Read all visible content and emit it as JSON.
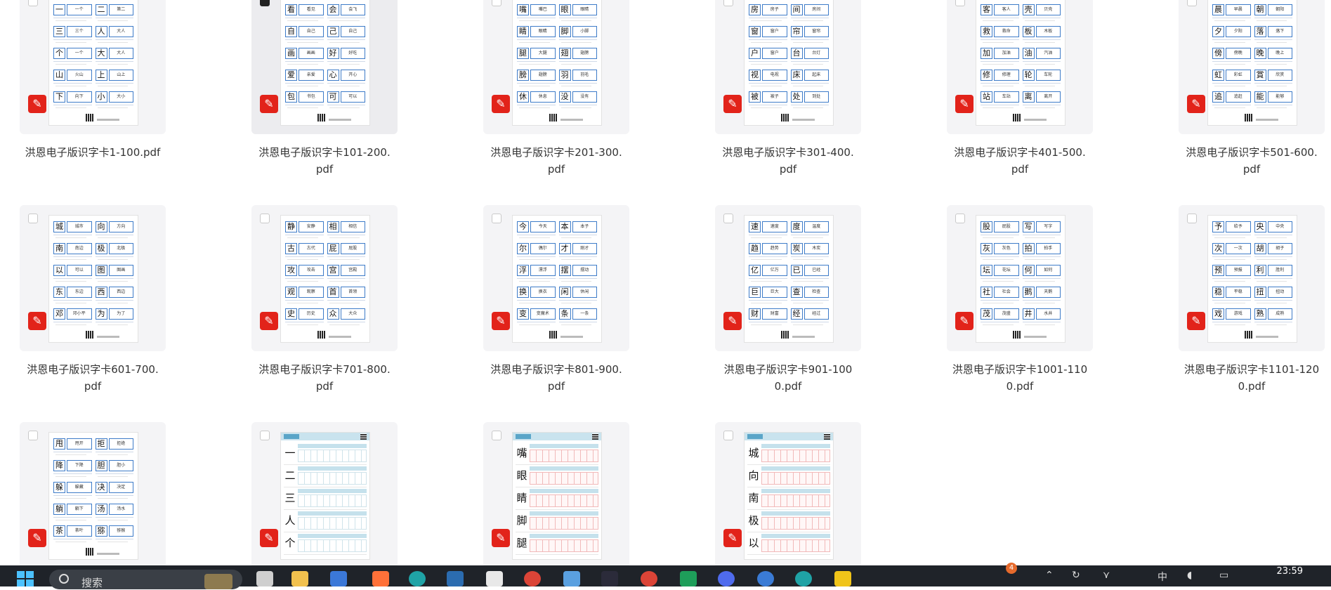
{
  "files": [
    {
      "name": "洪恩电子版识字卡1-100.pdf",
      "kind": "cards",
      "chars": [
        [
          "一",
          "一个"
        ],
        [
          "二",
          "第二"
        ],
        [
          "三",
          "三个"
        ],
        [
          "人",
          "大人"
        ],
        [
          "个",
          "一个"
        ],
        [
          "大",
          "大人"
        ],
        [
          "山",
          "火山"
        ],
        [
          "上",
          "山上"
        ],
        [
          "下",
          "向下"
        ],
        [
          "小",
          "大小"
        ]
      ]
    },
    {
      "name": "洪恩电子版识字卡101-200.\npdf",
      "kind": "cards",
      "checkbox": "dark",
      "highlighted": true,
      "chars": [
        [
          "看",
          "看见"
        ],
        [
          "会",
          "会飞"
        ],
        [
          "自",
          "自己"
        ],
        [
          "己",
          "自己"
        ],
        [
          "画",
          "画画"
        ],
        [
          "好",
          "好吃"
        ],
        [
          "爱",
          "亲爱"
        ],
        [
          "心",
          "开心"
        ],
        [
          "包",
          "书包"
        ],
        [
          "可",
          "可以"
        ]
      ]
    },
    {
      "name": "洪恩电子版识字卡201-300.\npdf",
      "kind": "cards",
      "chars": [
        [
          "嘴",
          "嘴巴"
        ],
        [
          "眼",
          "眼睛"
        ],
        [
          "睛",
          "眼睛"
        ],
        [
          "脚",
          "小脚"
        ],
        [
          "腿",
          "大腿"
        ],
        [
          "翅",
          "翅膀"
        ],
        [
          "膀",
          "翅膀"
        ],
        [
          "羽",
          "羽毛"
        ],
        [
          "休",
          "休息"
        ],
        [
          "没",
          "没有"
        ]
      ]
    },
    {
      "name": "洪恩电子版识字卡301-400.\npdf",
      "kind": "cards",
      "chars": [
        [
          "房",
          "房子"
        ],
        [
          "间",
          "房间"
        ],
        [
          "窗",
          "窗户"
        ],
        [
          "帘",
          "窗帘"
        ],
        [
          "户",
          "窗户"
        ],
        [
          "台",
          "台灯"
        ],
        [
          "视",
          "电视"
        ],
        [
          "床",
          "起床"
        ],
        [
          "被",
          "被子"
        ],
        [
          "处",
          "到处"
        ]
      ]
    },
    {
      "name": "洪恩电子版识字卡401-500.\npdf",
      "kind": "cards",
      "chars": [
        [
          "客",
          "客人"
        ],
        [
          "壳",
          "贝壳"
        ],
        [
          "救",
          "救命"
        ],
        [
          "板",
          "木板"
        ],
        [
          "加",
          "加油"
        ],
        [
          "油",
          "汽油"
        ],
        [
          "修",
          "修理"
        ],
        [
          "轮",
          "车轮"
        ],
        [
          "站",
          "车站"
        ],
        [
          "离",
          "离开"
        ]
      ]
    },
    {
      "name": "洪恩电子版识字卡501-600.\npdf",
      "kind": "cards",
      "chars": [
        [
          "晨",
          "早晨"
        ],
        [
          "朝",
          "朝阳"
        ],
        [
          "夕",
          "夕阳"
        ],
        [
          "落",
          "落下"
        ],
        [
          "傍",
          "傍晚"
        ],
        [
          "晚",
          "晚上"
        ],
        [
          "虹",
          "彩虹"
        ],
        [
          "賞",
          "欣赏"
        ],
        [
          "追",
          "追赶"
        ],
        [
          "能",
          "能够"
        ]
      ]
    },
    {
      "name": "洪恩电子版识字卡601-700.\npdf",
      "kind": "cards",
      "chars": [
        [
          "城",
          "城市"
        ],
        [
          "向",
          "方向"
        ],
        [
          "南",
          "南边"
        ],
        [
          "极",
          "北极"
        ],
        [
          "以",
          "可以"
        ],
        [
          "图",
          "图画"
        ],
        [
          "东",
          "东边"
        ],
        [
          "西",
          "西边"
        ],
        [
          "邓",
          "邓小平"
        ],
        [
          "为",
          "为了"
        ]
      ]
    },
    {
      "name": "洪恩电子版识字卡701-800.\npdf",
      "kind": "cards",
      "chars": [
        [
          "静",
          "安静"
        ],
        [
          "相",
          "相信"
        ],
        [
          "古",
          "古代"
        ],
        [
          "屁",
          "屁股"
        ],
        [
          "攻",
          "攻击"
        ],
        [
          "宫",
          "宫殿"
        ],
        [
          "观",
          "观察"
        ],
        [
          "首",
          "首领"
        ],
        [
          "史",
          "历史"
        ],
        [
          "众",
          "大众"
        ]
      ]
    },
    {
      "name": "洪恩电子版识字卡801-900.\npdf",
      "kind": "cards",
      "chars": [
        [
          "今",
          "今天"
        ],
        [
          "本",
          "本子"
        ],
        [
          "尔",
          "偶尔"
        ],
        [
          "才",
          "刚才"
        ],
        [
          "浮",
          "漂浮"
        ],
        [
          "摆",
          "摆动"
        ],
        [
          "换",
          "换衣"
        ],
        [
          "闲",
          "休闲"
        ],
        [
          "变",
          "变魔术"
        ],
        [
          "条",
          "一条"
        ]
      ]
    },
    {
      "name": "洪恩电子版识字卡901-100\n0.pdf",
      "kind": "cards",
      "chars": [
        [
          "速",
          "速度"
        ],
        [
          "度",
          "温度"
        ],
        [
          "趋",
          "趋势"
        ],
        [
          "炭",
          "木炭"
        ],
        [
          "亿",
          "亿万"
        ],
        [
          "已",
          "已经"
        ],
        [
          "巨",
          "巨大"
        ],
        [
          "查",
          "检查"
        ],
        [
          "财",
          "财富"
        ],
        [
          "经",
          "经过"
        ]
      ]
    },
    {
      "name": "洪恩电子版识字卡1001-110\n0.pdf",
      "kind": "cards",
      "chars": [
        [
          "股",
          "屁股"
        ],
        [
          "写",
          "写字"
        ],
        [
          "灰",
          "灰色"
        ],
        [
          "拍",
          "拍手"
        ],
        [
          "坛",
          "花坛"
        ],
        [
          "何",
          "如何"
        ],
        [
          "社",
          "社会"
        ],
        [
          "鹅",
          "天鹅"
        ],
        [
          "茂",
          "茂盛"
        ],
        [
          "井",
          "水井"
        ]
      ]
    },
    {
      "name": "洪恩电子版识字卡1101-120\n0.pdf",
      "kind": "cards",
      "chars": [
        [
          "予",
          "给予"
        ],
        [
          "央",
          "中央"
        ],
        [
          "次",
          "一次"
        ],
        [
          "胡",
          "胡子"
        ],
        [
          "预",
          "预报"
        ],
        [
          "利",
          "胜利"
        ],
        [
          "稳",
          "平稳"
        ],
        [
          "扭",
          "扭动"
        ],
        [
          "戏",
          "游戏"
        ],
        [
          "熟",
          "成熟"
        ]
      ]
    },
    {
      "name": "",
      "kind": "cards",
      "chars": [
        [
          "甩",
          "甩开"
        ],
        [
          "拒",
          "拒绝"
        ],
        [
          "降",
          "下降"
        ],
        [
          "胆",
          "胆小"
        ],
        [
          "躲",
          "躲藏"
        ],
        [
          "决",
          "决定"
        ],
        [
          "躺",
          "躺下"
        ],
        [
          "汤",
          "汤水"
        ],
        [
          "茶",
          "茶叶"
        ],
        [
          "猕",
          "猕猴"
        ]
      ]
    },
    {
      "name": "",
      "kind": "worksheet",
      "chars": [
        "一",
        "二",
        "三",
        "人",
        "个"
      ],
      "red": false
    },
    {
      "name": "",
      "kind": "worksheet",
      "chars": [
        "嘴",
        "眼",
        "睛",
        "脚",
        "腿"
      ],
      "red": true
    },
    {
      "name": "",
      "kind": "worksheet",
      "chars": [
        "城",
        "向",
        "南",
        "极",
        "以"
      ],
      "red": true
    }
  ],
  "taskbar": {
    "search_placeholder": "搜索",
    "notification_count": "4",
    "ime_label": "中",
    "clock": "23:59",
    "icons": [
      "file-explorer-icon",
      "folder-icon",
      "calculator-icon",
      "firefox-icon",
      "edge-icon",
      "media-icon",
      "document-icon",
      "chrome-icon",
      "news-icon",
      "pk-app-icon",
      "chrome-icon",
      "sheets-icon",
      "browser-icon",
      "search-app-icon",
      "edge-icon",
      "qq-icon"
    ]
  }
}
